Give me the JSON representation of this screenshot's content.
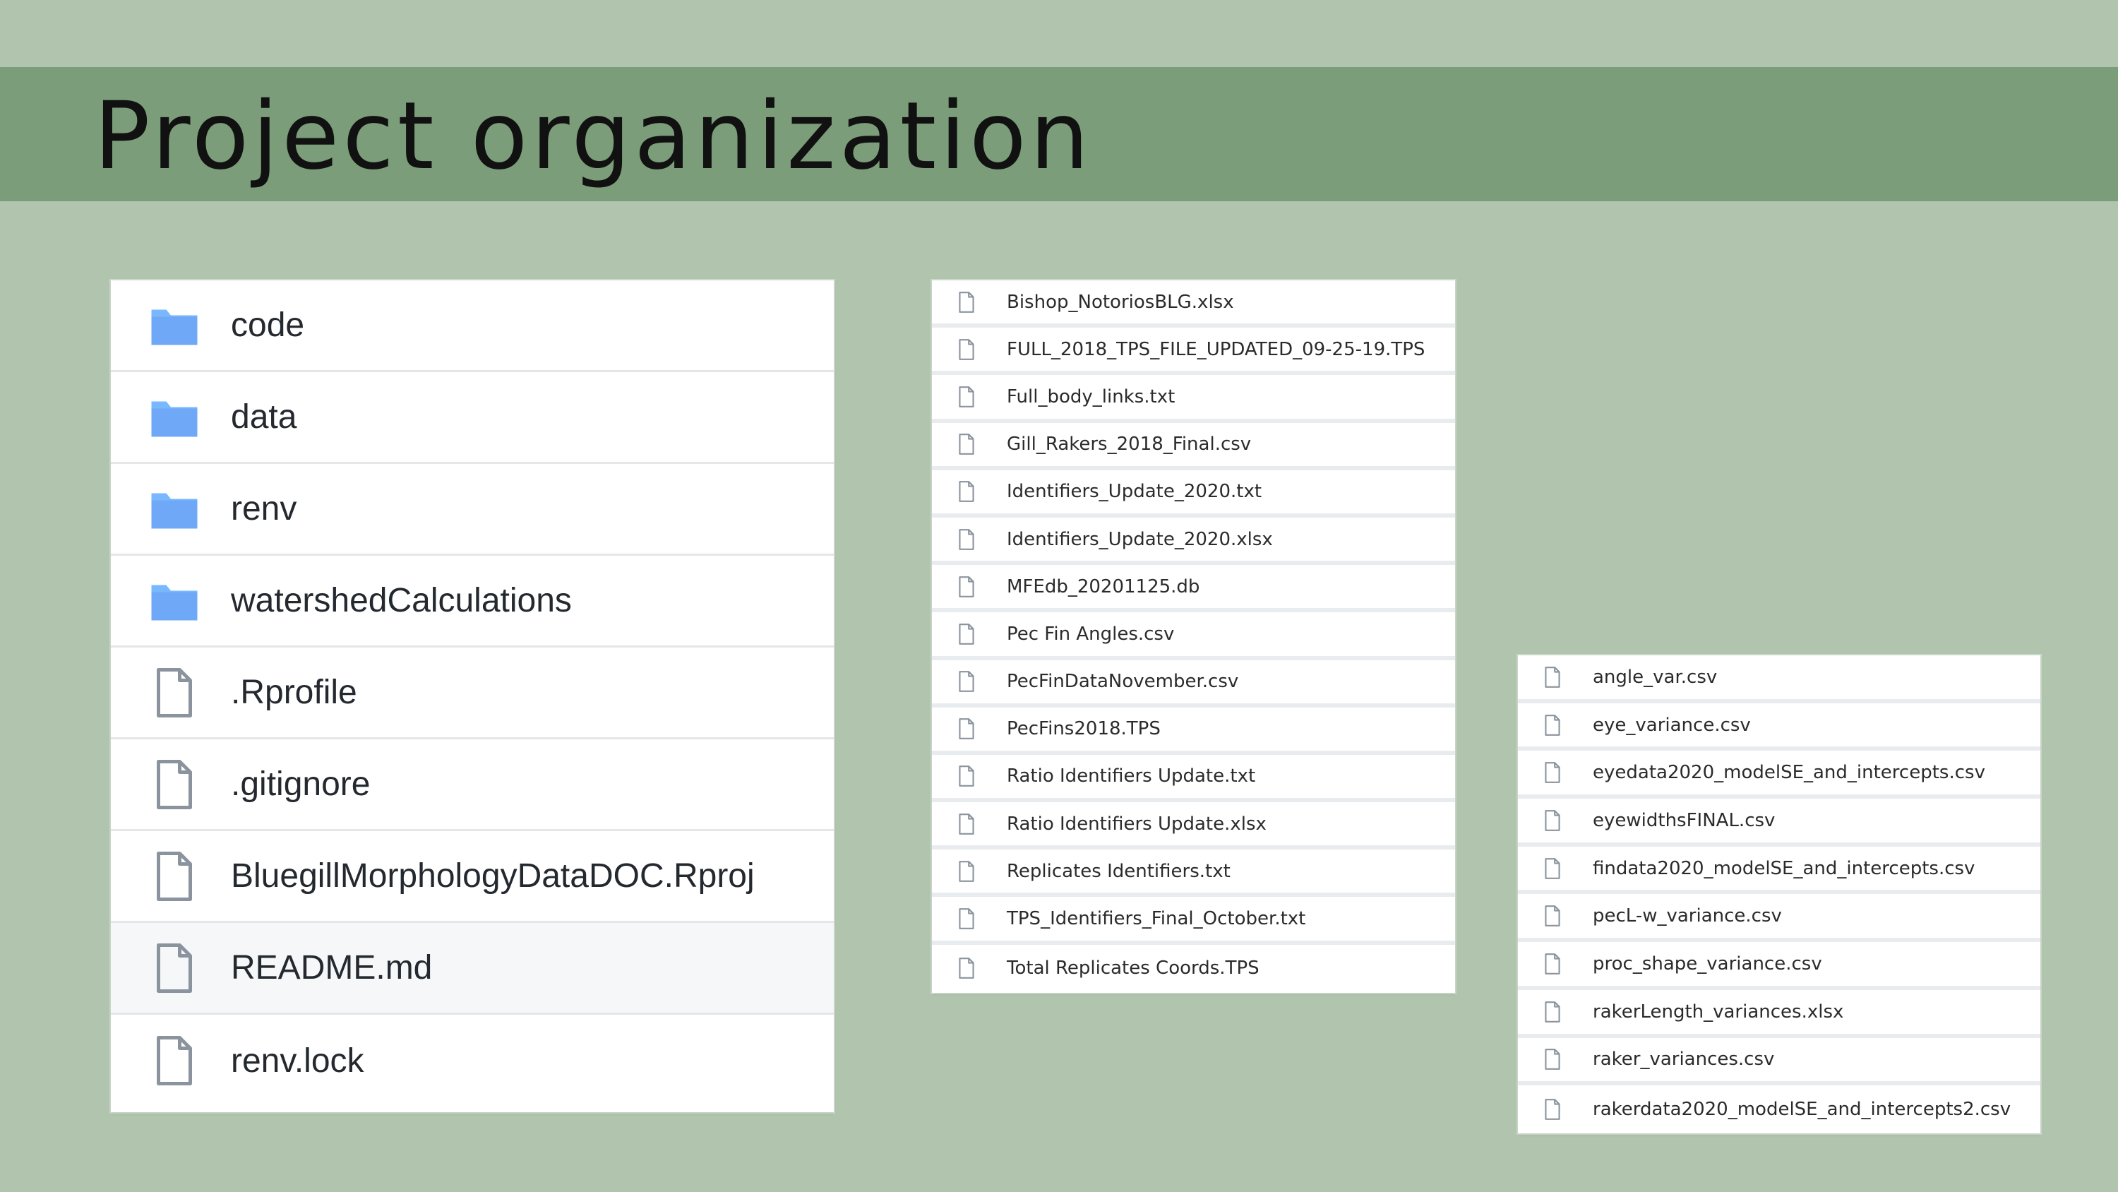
{
  "slide": {
    "title": "Project organization",
    "background_color": "#b0c4ae",
    "band_color": "#7b9d7a"
  },
  "main_listing": {
    "items": [
      {
        "name": "code",
        "type": "folder",
        "icon": "folder-icon"
      },
      {
        "name": "data",
        "type": "folder",
        "icon": "folder-icon"
      },
      {
        "name": "renv",
        "type": "folder",
        "icon": "folder-icon"
      },
      {
        "name": "watershedCalculations",
        "type": "folder",
        "icon": "folder-icon"
      },
      {
        "name": ".Rprofile",
        "type": "file",
        "icon": "file-icon"
      },
      {
        "name": ".gitignore",
        "type": "file",
        "icon": "file-icon"
      },
      {
        "name": "BluegillMorphologyDataDOC.Rproj",
        "type": "file",
        "icon": "file-icon"
      },
      {
        "name": "README.md",
        "type": "file",
        "icon": "file-icon"
      },
      {
        "name": "renv.lock",
        "type": "file",
        "icon": "file-icon"
      }
    ]
  },
  "data_listing": {
    "items": [
      {
        "name": "Bishop_NotoriosBLG.xlsx",
        "icon": "file-icon"
      },
      {
        "name": "FULL_2018_TPS_FILE_UPDATED_09-25-19.TPS",
        "icon": "file-icon"
      },
      {
        "name": "Full_body_links.txt",
        "icon": "file-icon"
      },
      {
        "name": "Gill_Rakers_2018_Final.csv",
        "icon": "file-icon"
      },
      {
        "name": "Identifiers_Update_2020.txt",
        "icon": "file-icon"
      },
      {
        "name": "Identifiers_Update_2020.xlsx",
        "icon": "file-icon"
      },
      {
        "name": "MFEdb_20201125.db",
        "icon": "file-icon"
      },
      {
        "name": "Pec Fin Angles.csv",
        "icon": "file-icon"
      },
      {
        "name": "PecFinDataNovember.csv",
        "icon": "file-icon"
      },
      {
        "name": "PecFins2018.TPS",
        "icon": "file-icon"
      },
      {
        "name": "Ratio Identifiers Update.txt",
        "icon": "file-icon"
      },
      {
        "name": "Ratio Identifiers Update.xlsx",
        "icon": "file-icon"
      },
      {
        "name": "Replicates Identifiers.txt",
        "icon": "file-icon"
      },
      {
        "name": "TPS_Identifiers_Final_October.txt",
        "icon": "file-icon"
      },
      {
        "name": "Total Replicates Coords.TPS",
        "icon": "file-icon"
      }
    ]
  },
  "variance_listing": {
    "items": [
      {
        "name": "angle_var.csv",
        "icon": "file-icon"
      },
      {
        "name": "eye_variance.csv",
        "icon": "file-icon"
      },
      {
        "name": "eyedata2020_modelSE_and_intercepts.csv",
        "icon": "file-icon"
      },
      {
        "name": "eyewidthsFINAL.csv",
        "icon": "file-icon"
      },
      {
        "name": "findata2020_modelSE_and_intercepts.csv",
        "icon": "file-icon"
      },
      {
        "name": "pecL-w_variance.csv",
        "icon": "file-icon"
      },
      {
        "name": "proc_shape_variance.csv",
        "icon": "file-icon"
      },
      {
        "name": "rakerLength_variances.xlsx",
        "icon": "file-icon"
      },
      {
        "name": "raker_variances.csv",
        "icon": "file-icon"
      },
      {
        "name": "rakerdata2020_modelSE_and_intercepts2.csv",
        "icon": "file-icon"
      }
    ]
  }
}
